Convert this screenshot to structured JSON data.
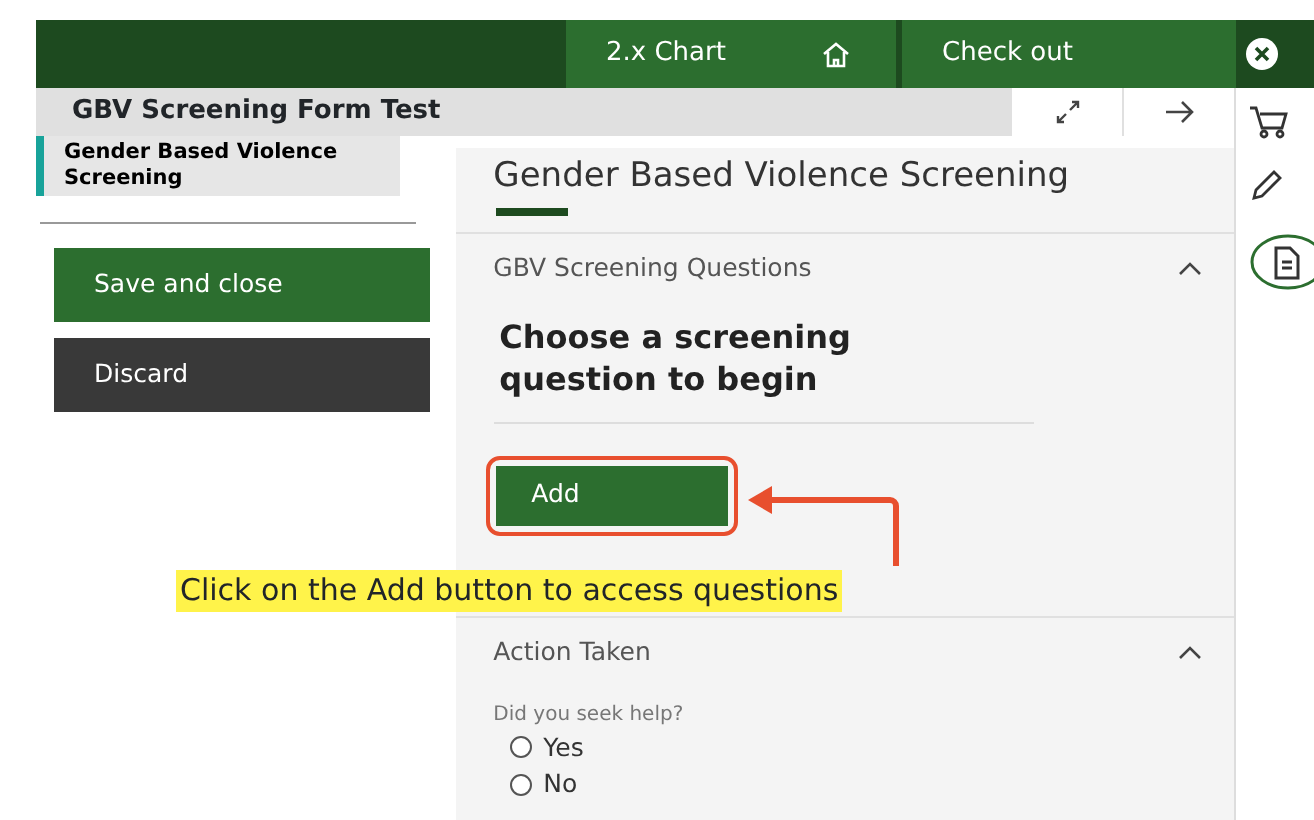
{
  "header": {
    "tabs": [
      {
        "label": "2.x Chart",
        "kind": "chart"
      },
      {
        "label": "Check out",
        "kind": "checkout"
      }
    ]
  },
  "form": {
    "title": "GBV Screening Form Test"
  },
  "sidebar": {
    "items": [
      {
        "label": "Gender Based Violence Screening",
        "selected": true
      }
    ],
    "buttons": [
      {
        "label": "Save and close",
        "kind": "primary"
      },
      {
        "label": "Discard",
        "kind": "secondary"
      }
    ]
  },
  "main": {
    "title": "Gender Based Violence Screening",
    "sections": [
      {
        "title": "GBV Screening Questions",
        "expanded": true,
        "kind": "questions",
        "heading": "Choose a screening question to begin",
        "button": "Add"
      },
      {
        "title": "Action Taken",
        "expanded": true,
        "kind": "radio",
        "question": "Did you seek help?",
        "options": [
          {
            "label": "Yes",
            "selected": false
          },
          {
            "label": "No",
            "selected": false
          }
        ]
      }
    ]
  },
  "annotation": {
    "text": "Click on the Add button to access questions"
  }
}
